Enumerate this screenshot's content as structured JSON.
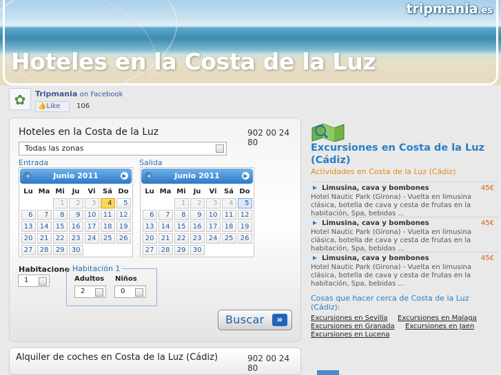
{
  "banner": {
    "title": "Hoteles en la Costa de la Luz",
    "logo": "tripmania",
    "logo_tld": ".es"
  },
  "facebook": {
    "page_name": "Tripmania",
    "on_facebook": "on Facebook",
    "like_label": "Like",
    "like_count": "106"
  },
  "search": {
    "title": "Hoteles en la Costa de la Luz",
    "phone": "902 00 24 80",
    "zone_value": "Todas las zonas",
    "entrada_label": "Entrada",
    "salida_label": "Salida",
    "calendars": [
      {
        "month": "Junio 2011",
        "selected_day": 4,
        "highlight": "today"
      },
      {
        "month": "Junio 2011",
        "selected_day": 5,
        "highlight": "range"
      }
    ],
    "weekdays": [
      "Lu",
      "Ma",
      "Mi",
      "Ju",
      "Vi",
      "Sá",
      "Do"
    ],
    "habitaciones_label": "Habitaciones",
    "habitaciones_value": "1",
    "habitacion_title": "Habitación 1",
    "adultos_label": "Adultos",
    "adultos_value": "2",
    "ninos_label": "Niños",
    "ninos_value": "0",
    "buscar_label": "Buscar"
  },
  "cars": {
    "title": "Alquiler de coches en Costa de la Luz (Cádiz)",
    "phone": "902 00 24 80"
  },
  "excursions": {
    "title": "Excursiones en Costa de la Luz (Cádiz)",
    "subtitle": "Actividades en Costa de la Luz (Cádiz)",
    "items": [
      {
        "title": "Limusina, cava y bombones",
        "price": "45€",
        "desc": "Hotel Nautic Park (Girona) - Vuelta en limusina clásica, botella de cava y cesta de frutas en la habitación, Spa, bebidas ..."
      },
      {
        "title": "Limusina, cava y bombones",
        "price": "45€",
        "desc": "Hotel Nautic Park (Girona) - Vuelta en limusina clásica, botella de cava y cesta de frutas en la habitación, Spa, bebidas ..."
      },
      {
        "title": "Limusina, cava y bombones",
        "price": "45€",
        "desc": "Hotel Nautic Park (Girona) - Vuelta en limusina clásica, botella de cava y cesta de frutas en la habitación, Spa, bebidas ..."
      }
    ],
    "cosas_title": "Cosas que hacer cerca de Costa de la Luz (Cádiz):",
    "links": [
      "Excursiones en Sevilla",
      "Excursiones en Malaga",
      "Excursiones en Granada",
      "Excursiones en Jaen",
      "Excursiones en Lucena"
    ]
  },
  "colors": {
    "accent_blue": "#2a7ec4",
    "price_orange": "#e0590f",
    "subtitle_orange": "#e48b12"
  }
}
